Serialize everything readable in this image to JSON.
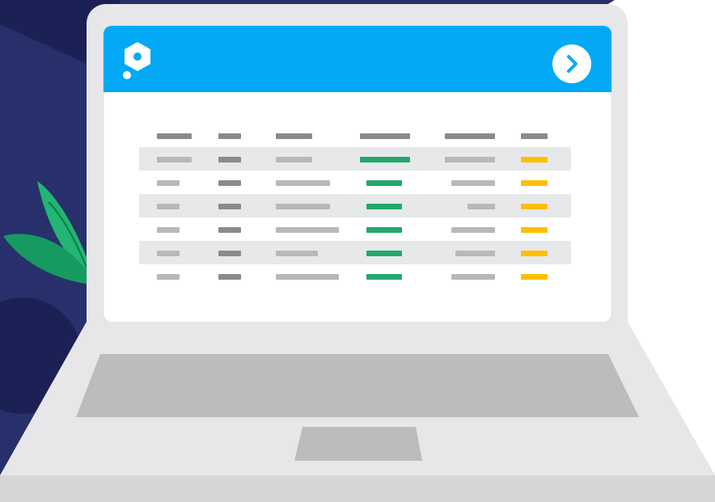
{
  "colors": {
    "background_navy": "#27306a",
    "background_dark": "#1b2155",
    "leaf_green": "#22b573",
    "leaf_dark": "#169a5f",
    "laptop_body": "#e7e7e9",
    "laptop_keyboard": "#bcbcbc",
    "header_blue": "#03a9f4",
    "row_shade": "#e7e8ea",
    "placeholder_dark": "#8a8a8a",
    "placeholder_light": "#b8b8b8",
    "status_green": "#22a86a",
    "status_yellow": "#ffbf00"
  },
  "icons": {
    "logo": "hexagon-logo-icon",
    "next": "chevron-right-icon"
  },
  "table": {
    "rows": 6,
    "columns": 6
  }
}
